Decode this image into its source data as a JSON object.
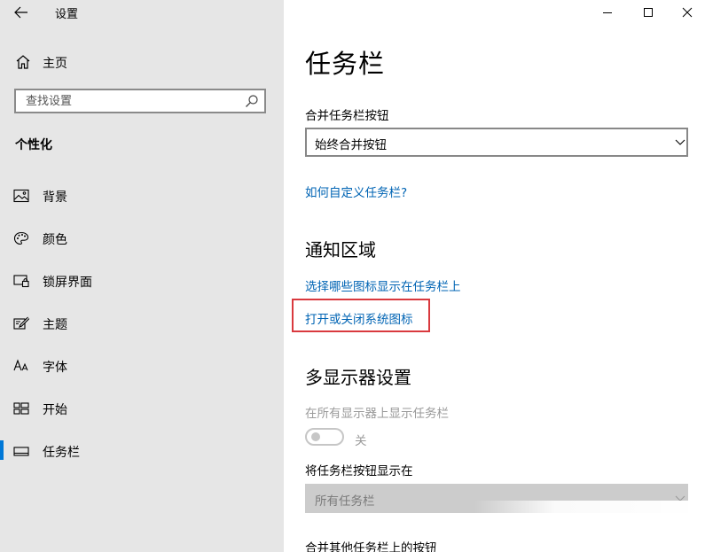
{
  "app": {
    "title": "设置"
  },
  "sidebar": {
    "home_label": "主页",
    "search": {
      "placeholder": "查找设置"
    },
    "section_title": "个性化",
    "items": [
      {
        "label": "背景",
        "icon": "picture-icon"
      },
      {
        "label": "颜色",
        "icon": "palette-icon"
      },
      {
        "label": "锁屏界面",
        "icon": "lock-screen-icon"
      },
      {
        "label": "主题",
        "icon": "theme-brush-icon"
      },
      {
        "label": "字体",
        "icon": "font-icon"
      },
      {
        "label": "开始",
        "icon": "start-menu-icon"
      },
      {
        "label": "任务栏",
        "icon": "taskbar-icon",
        "active": true
      }
    ],
    "accent_color": "#0078d7"
  },
  "main": {
    "page_title": "任务栏",
    "combine_label": "合并任务栏按钮",
    "combine_value": "始终合并按钮",
    "customize_link": "如何自定义任务栏?",
    "notification_heading": "通知区域",
    "select_icons_link": "选择哪些图标显示在任务栏上",
    "system_icons_link": "打开或关闭系统图标",
    "multi_display_heading": "多显示器设置",
    "show_on_all_label": "在所有显示器上显示任务栏",
    "toggle_state": "关",
    "show_buttons_label": "将任务栏按钮显示在",
    "show_buttons_value": "所有任务栏",
    "combine_other_label": "合并其他任务栏上的按钮",
    "link_color": "#0064b4",
    "highlight_color": "#d9393e"
  }
}
